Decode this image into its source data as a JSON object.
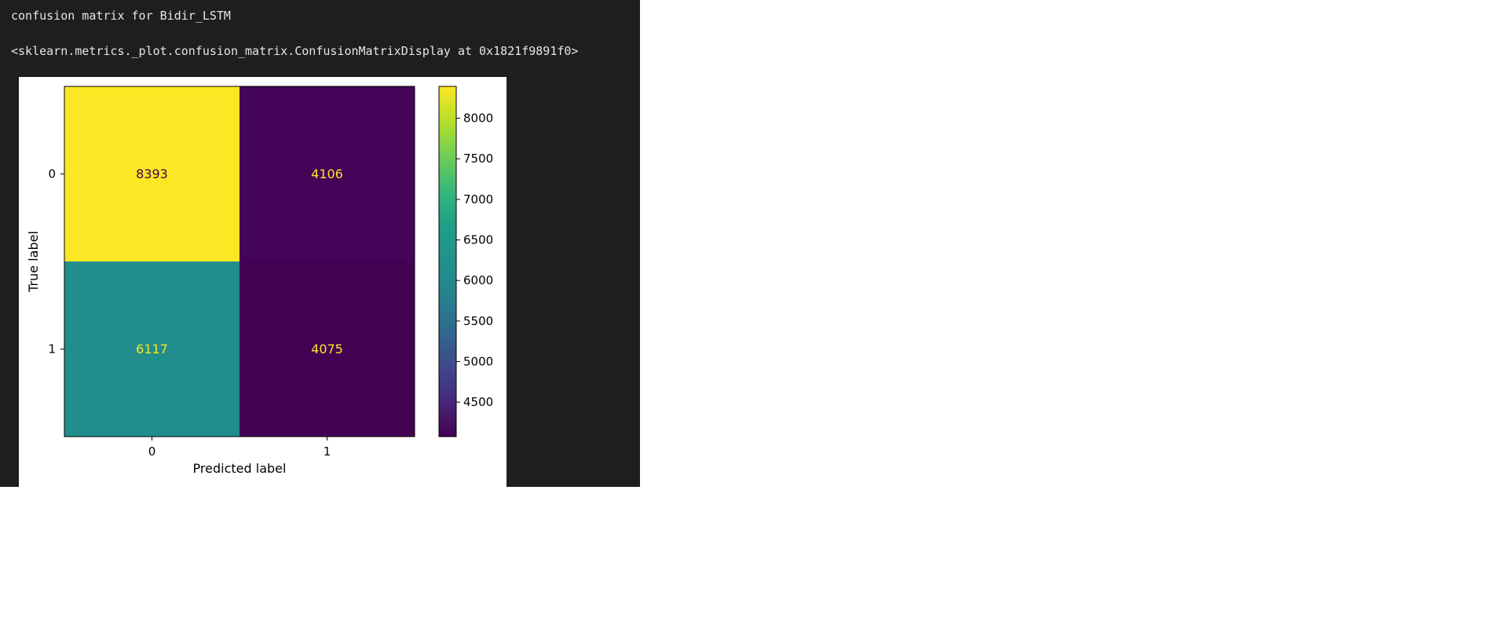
{
  "cell_output": {
    "stdout": "confusion matrix for Bidir_LSTM",
    "repr": "<sklearn.metrics._plot.confusion_matrix.ConfusionMatrixDisplay at 0x1821f9891f0>"
  },
  "chart_data": {
    "type": "heatmap",
    "title": "",
    "xlabel": "Predicted label",
    "ylabel": "True label",
    "x_ticks": [
      "0",
      "1"
    ],
    "y_ticks": [
      "0",
      "1"
    ],
    "matrix": [
      [
        8393,
        4106
      ],
      [
        6117,
        4075
      ]
    ],
    "colormap": "viridis",
    "colorbar": {
      "range": [
        4075,
        8393
      ],
      "ticks": [
        4500,
        5000,
        5500,
        6000,
        6500,
        7000,
        7500,
        8000
      ]
    },
    "text_colors": {
      "on_light": "#440154",
      "on_dark": "#fde725"
    },
    "grid": false
  }
}
